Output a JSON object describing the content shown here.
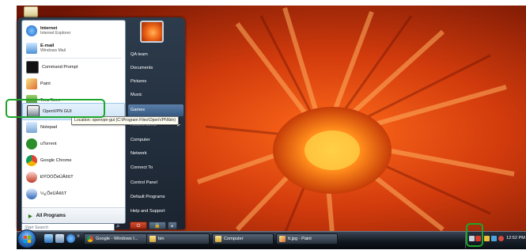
{
  "start_menu": {
    "pinned": [
      {
        "title": "Internet",
        "subtitle": "Internet Explorer",
        "icon": "internet-explorer-icon"
      },
      {
        "title": "E-mail",
        "subtitle": "Windows Mail",
        "icon": "windows-mail-icon"
      }
    ],
    "recent": [
      {
        "label": "Command Prompt",
        "icon": "command-prompt-icon"
      },
      {
        "label": "Paint",
        "icon": "paint-icon"
      },
      {
        "label": "Tera Term",
        "icon": "tera-term-icon"
      },
      {
        "label": "OpenVPN GUI",
        "icon": "openvpn-icon"
      },
      {
        "label": "Notepad",
        "icon": "notepad-icon"
      },
      {
        "label": "uTorrent",
        "icon": "utorrent-icon"
      },
      {
        "label": "Google Chrome",
        "icon": "chrome-icon"
      },
      {
        "label": "ÐŸÓÖÕéÜÂ¢ßT",
        "icon": "app-icon"
      },
      {
        "label": "½¿ÕéÜÂ¢ßT",
        "icon": "app-icon"
      }
    ],
    "all_programs": "All Programs",
    "search_placeholder": "Start Search",
    "places": [
      "QA team",
      "Documents",
      "Pictures",
      "Music",
      "Games",
      "Recent Items",
      "Computer",
      "Network",
      "Connect To",
      "Control Panel",
      "Default Programs",
      "Help and Support"
    ],
    "power_symbol": "⏻",
    "lock_symbol": "🔒",
    "more_symbol": "▸"
  },
  "tooltip": "Location: openvpn-gui (C:\\Program Files\\OpenVPN\\bin)",
  "taskbar": {
    "quicklaunch_overflow": "»",
    "buttons": [
      {
        "label": "Google - Windows I...",
        "icon": "chrome-icon"
      },
      {
        "label": "bin",
        "icon": "folder-icon"
      },
      {
        "label": "Computer",
        "icon": "computer-icon"
      },
      {
        "label": "tt.jpg - Paint",
        "icon": "paint-icon"
      }
    ],
    "clock": "12:52 PM"
  },
  "colors": {
    "annotation": "#1ea52b",
    "selection": "#cfe4f7"
  }
}
